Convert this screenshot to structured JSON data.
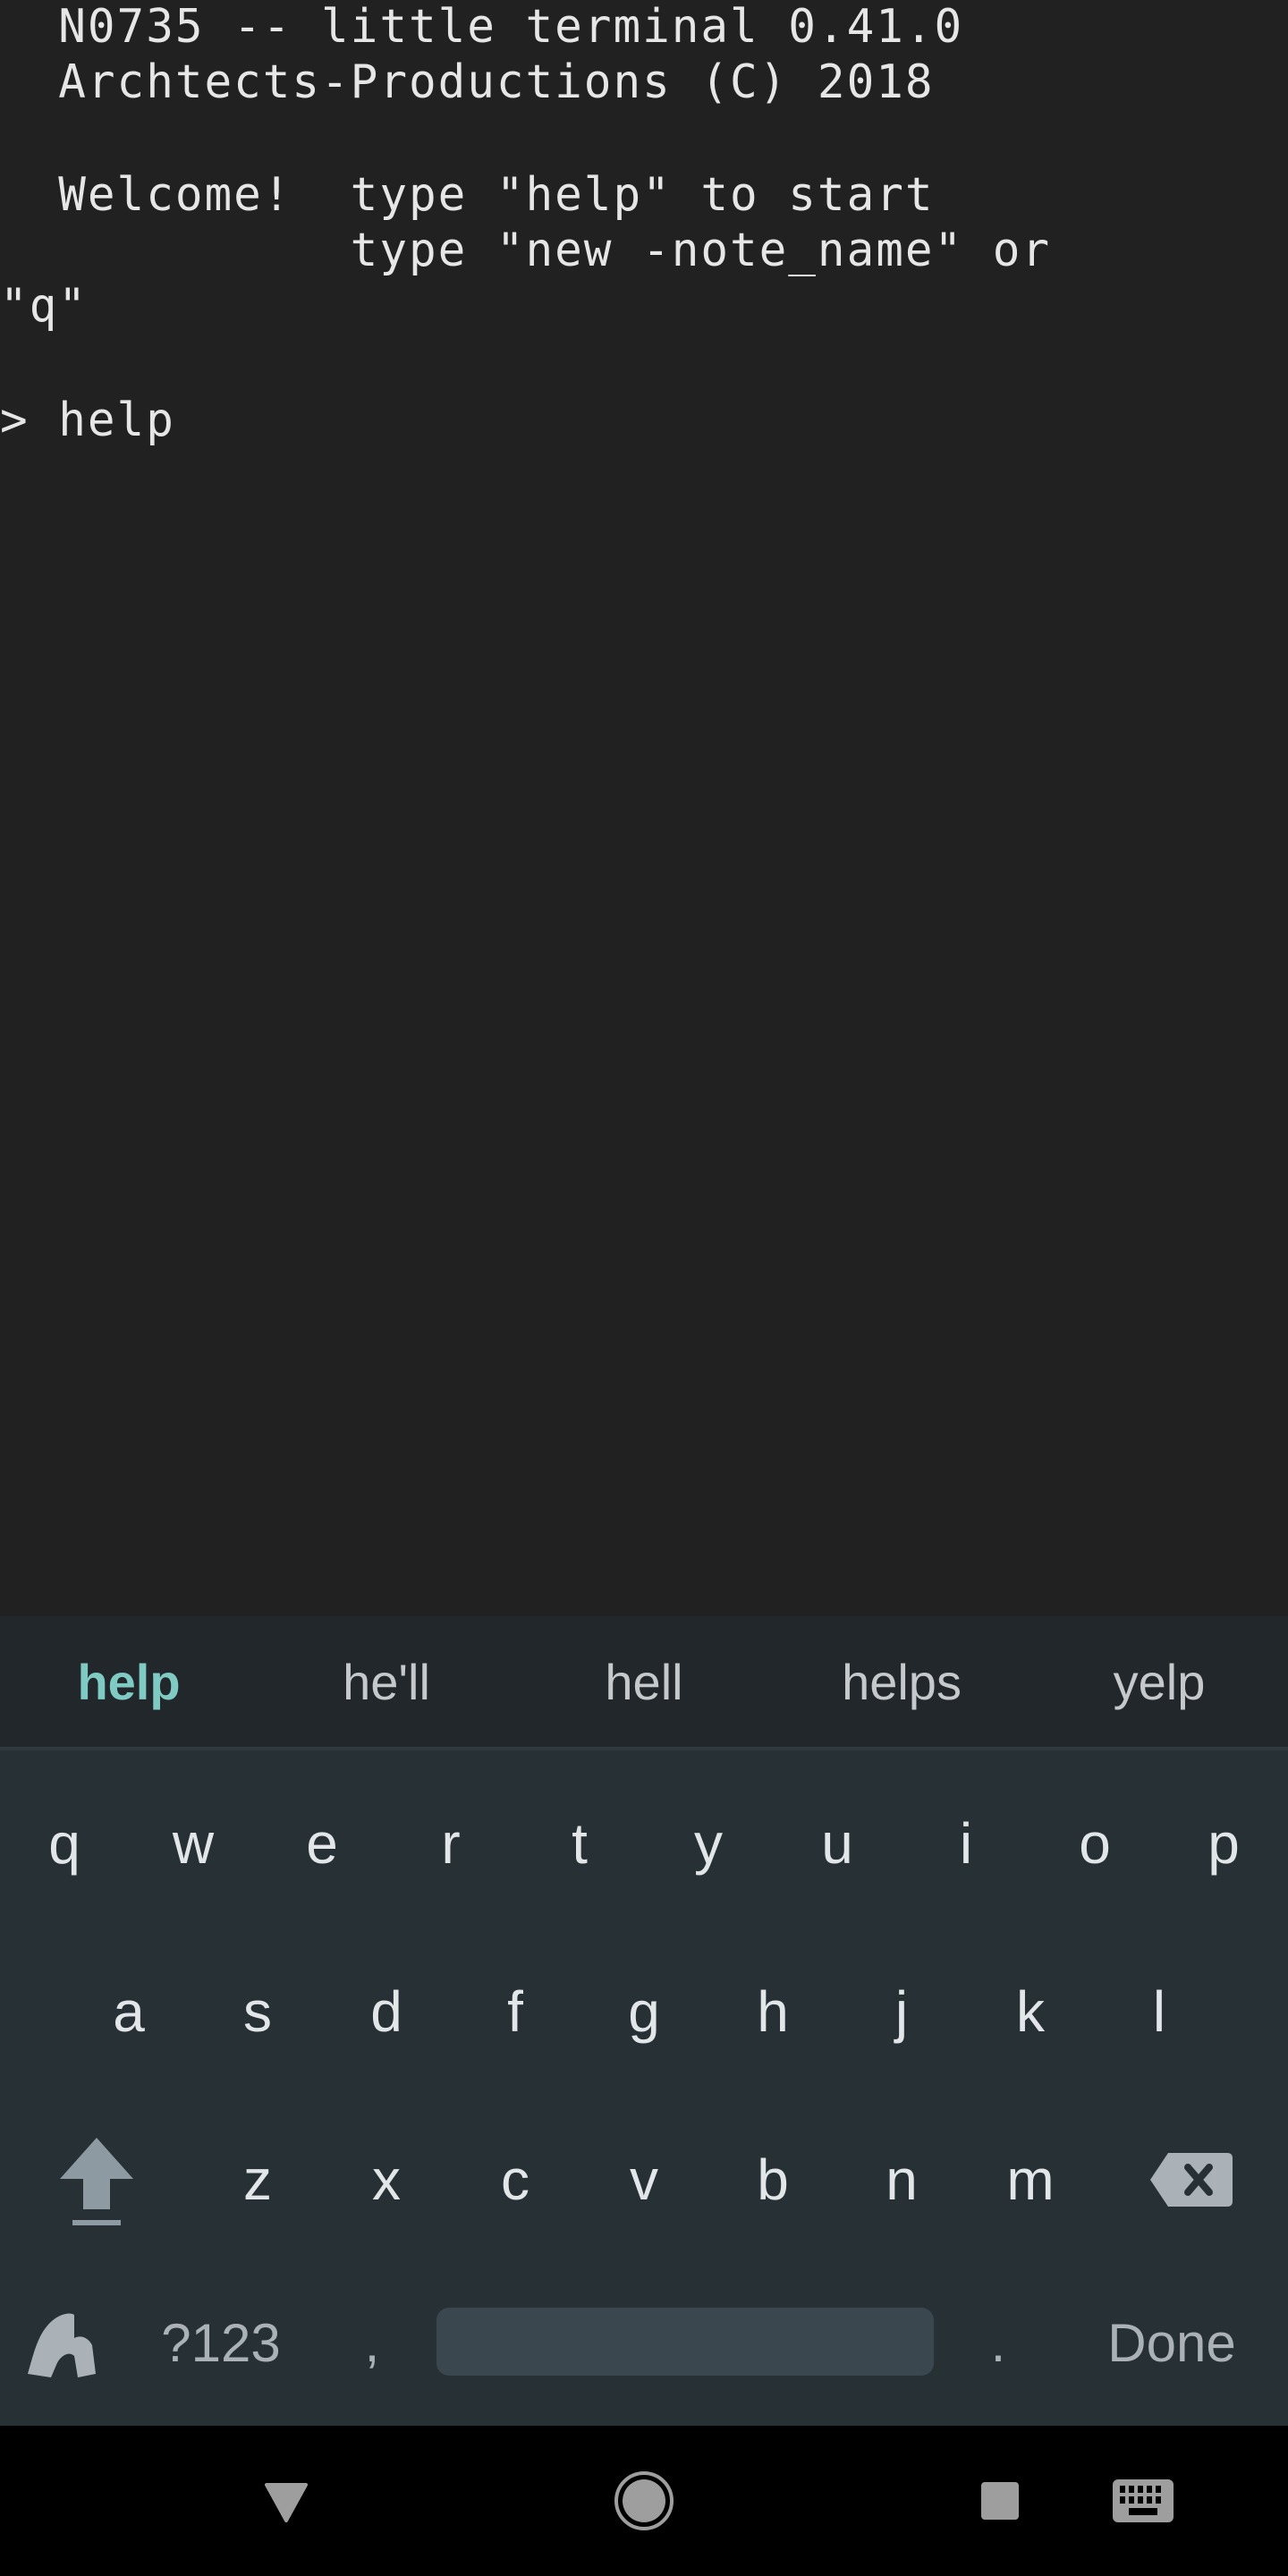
{
  "terminal": {
    "lines": [
      "  N0735 -- little terminal 0.41.0",
      "  Archtects-Productions (C) 2018",
      "",
      "  Welcome!  type \"help\" to start",
      "            type \"new -note_name\" or",
      "\"q\"",
      "",
      "> help"
    ],
    "text_color": "#e6e6e6",
    "background": "#212121"
  },
  "suggestions": {
    "items": [
      "help",
      "he'll",
      "hell",
      "helps",
      "yelp"
    ],
    "primary_index": 0,
    "primary_color": "#7fcbc4"
  },
  "keyboard": {
    "row1": [
      "q",
      "w",
      "e",
      "r",
      "t",
      "y",
      "u",
      "i",
      "o",
      "p"
    ],
    "row2": [
      "a",
      "s",
      "d",
      "f",
      "g",
      "h",
      "j",
      "k",
      "l"
    ],
    "row3": [
      "z",
      "x",
      "c",
      "v",
      "b",
      "n",
      "m"
    ],
    "shift_icon": "shift-arrow-icon",
    "backspace_icon": "backspace-icon",
    "handwriting_icon": "handwriting-icon",
    "symbols_label": "?123",
    "comma_label": ",",
    "period_label": ".",
    "action_label": "Done",
    "background": "#263035"
  },
  "navbar": {
    "back_icon": "back-triangle-icon",
    "home_icon": "home-circle-icon",
    "recents_icon": "recents-square-icon",
    "keyboard_icon": "keyboard-switch-icon"
  }
}
